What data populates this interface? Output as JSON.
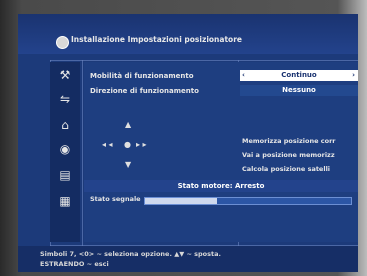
{
  "window": {
    "title": "Installazione Impostazioni posizionatore"
  },
  "sidebar": {
    "icons": [
      "tools-icon",
      "satellite-icon",
      "lock-icon",
      "disc-icon",
      "archive-icon",
      "calendar-icon"
    ]
  },
  "settings": {
    "mobility_label": "Mobilità di funzionamento",
    "mobility_value": "Continuo",
    "direction_label": "Direzione di funzionamento",
    "direction_value": "Nessuno"
  },
  "actions": [
    "Memorizza posizione corr",
    "Vai a posizione memorizz",
    "Calcola posizione satelli"
  ],
  "status": {
    "motor_status": "Stato motore: Arresto",
    "signal_label": "Stato segnale",
    "signal_level": 0.35
  },
  "help": {
    "line1": "Simboli 7, <0> ~ seleziona opzione. ▲▼ ~ sposta.",
    "line2": "ESTRAENDO ~ esci"
  }
}
